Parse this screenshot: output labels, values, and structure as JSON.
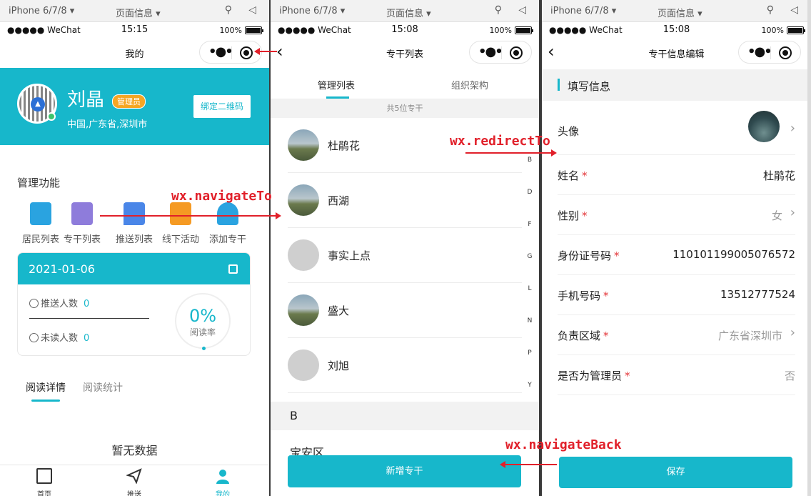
{
  "devtools": {
    "device": "iPhone 6/7/8 ▾",
    "page_info": "页面信息 ▾"
  },
  "colors": {
    "accent": "#17b7cb",
    "annotation": "#e1202a",
    "required": "#e4393c"
  },
  "phone1": {
    "status": {
      "carrier": "●●●●● WeChat",
      "time": "15:15",
      "battery": "100%"
    },
    "nav_title": "我的",
    "profile": {
      "name": "刘晶",
      "badge": "管理员",
      "region": "中国,广东省,深圳市",
      "bind_button": "绑定二维码"
    },
    "manage_title": "管理功能",
    "functions": [
      {
        "label": "居民列表",
        "icon": "building-icon",
        "color": "#2aa3e0"
      },
      {
        "label": "专干列表",
        "icon": "document-icon",
        "color": "#8e7cdb"
      },
      {
        "label": "推送列表",
        "icon": "message-icon",
        "color": "#4a86e8"
      },
      {
        "label": "线下活动",
        "icon": "calendar-icon",
        "color": "#f59a23"
      },
      {
        "label": "添加专干",
        "icon": "add-user-icon",
        "color": "#2aa3e0"
      }
    ],
    "read_card": {
      "date": "2021-01-06",
      "pushed_label": "推送人数",
      "pushed_value": "0",
      "unread_label": "未读人数",
      "unread_value": "0",
      "rate_value": "0%",
      "rate_label": "阅读率"
    },
    "tabs": [
      "阅读详情",
      "阅读统计"
    ],
    "empty_text": "暂无数据",
    "tabbar": [
      "首页",
      "推送",
      "我的"
    ]
  },
  "phone2": {
    "status": {
      "carrier": "●●●●● WeChat",
      "time": "15:08",
      "battery": "100%"
    },
    "nav_title": "专干列表",
    "tabs": [
      "管理列表",
      "组织架构"
    ],
    "count_text": "共5位专干",
    "members": [
      {
        "name": "杜鹃花",
        "photo": true
      },
      {
        "name": "西湖",
        "photo": true
      },
      {
        "name": "事实上点",
        "photo": false
      },
      {
        "name": "盛大",
        "photo": true
      },
      {
        "name": "刘旭",
        "photo": false
      }
    ],
    "index_letters": [
      "B",
      "D",
      "F",
      "G",
      "L",
      "N",
      "P",
      "Y"
    ],
    "section_header": "B",
    "section_item": "宝安区",
    "add_button": "新增专干"
  },
  "phone3": {
    "status": {
      "carrier": "●●●●● WeChat",
      "time": "15:08",
      "battery": "100%"
    },
    "nav_title": "专干信息编辑",
    "section_title": "填写信息",
    "fields": {
      "avatar_label": "头像",
      "name_label": "姓名",
      "name_value": "杜鹃花",
      "gender_label": "性别",
      "gender_value": "女",
      "id_label": "身份证号码",
      "id_value": "110101199005076572",
      "phone_label": "手机号码",
      "phone_value": "13512777524",
      "area_label": "负责区域",
      "area_value": "广东省深圳市",
      "admin_label": "是否为管理员",
      "admin_value": "否"
    },
    "required_mark": "*",
    "save_button": "保存"
  },
  "annotations": {
    "navigate_to": "wx.navigateTo",
    "redirect_to": "wx.redirectTo",
    "navigate_back": "wx.navigateBack"
  }
}
